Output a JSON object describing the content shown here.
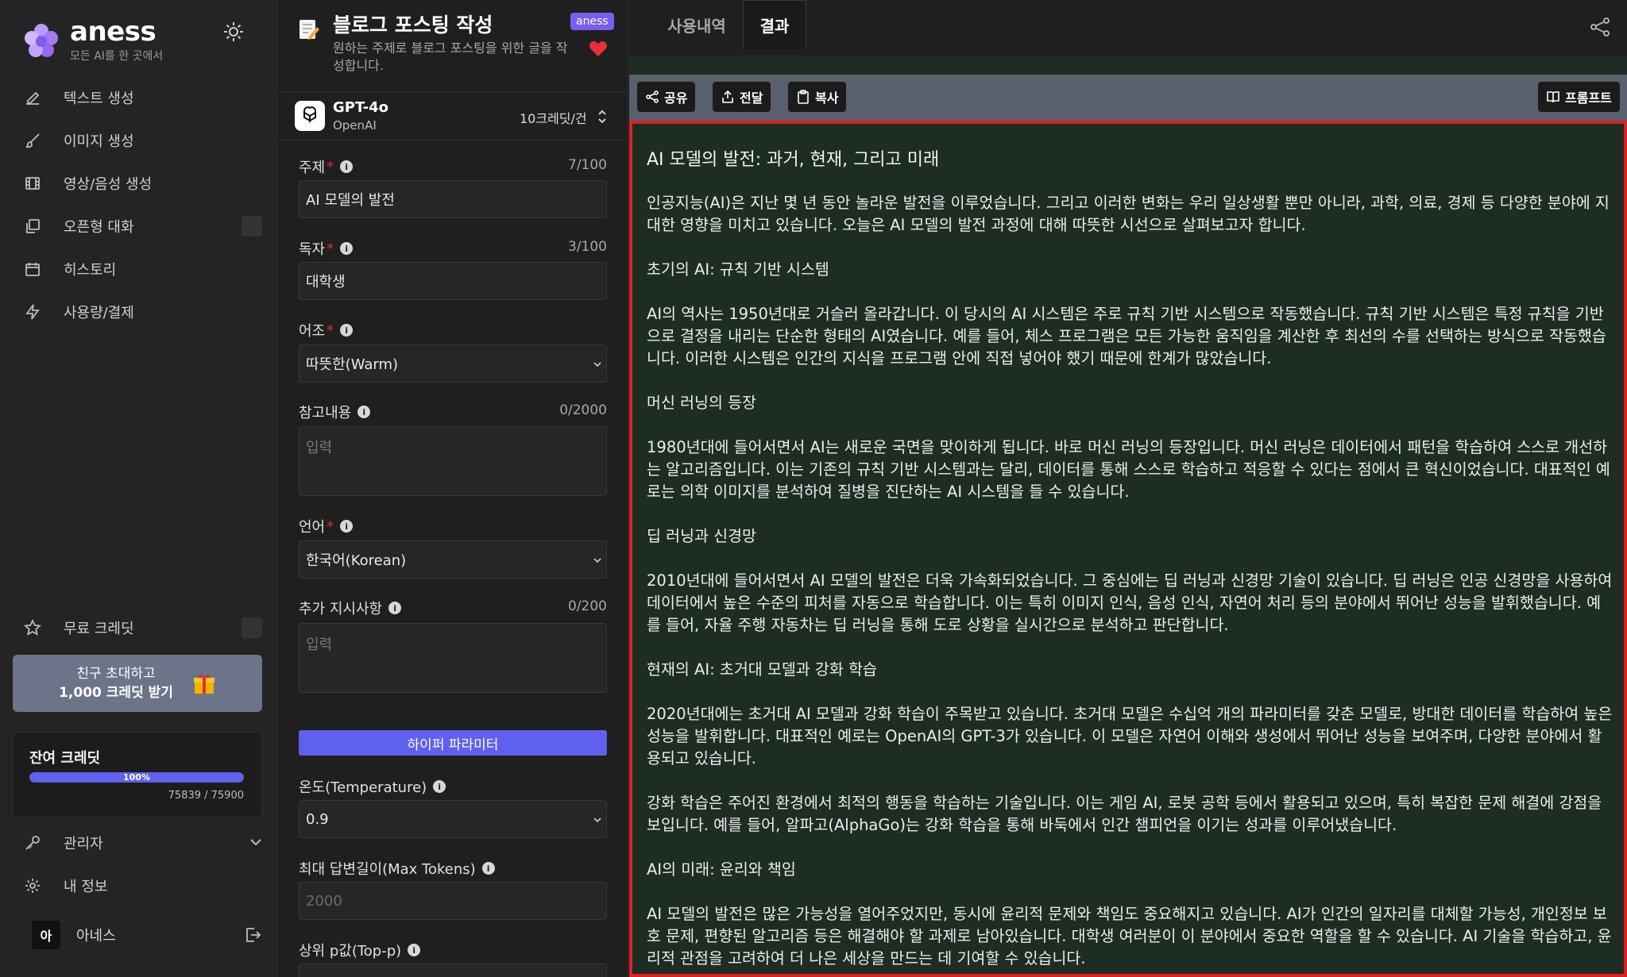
{
  "brand": {
    "name": "aness",
    "tagline": "모든 AI를 한 곳에서"
  },
  "nav": [
    {
      "label": "텍스트 생성",
      "icon": "edit-icon"
    },
    {
      "label": "이미지 생성",
      "icon": "brush-icon"
    },
    {
      "label": "영상/음성 생성",
      "icon": "film-icon"
    },
    {
      "label": "오픈형 대화",
      "icon": "chat-icon"
    },
    {
      "label": "히스토리",
      "icon": "calendar-icon"
    },
    {
      "label": "사용량/결제",
      "icon": "bolt-icon"
    }
  ],
  "free_credit": {
    "label": "무료 크레딧"
  },
  "invite": {
    "line1": "친구 초대하고",
    "line2": "1,000 크레딧 받기"
  },
  "credit": {
    "title": "잔여 크레딧",
    "percent_label": "100%",
    "fill_fraction": 1.0,
    "count": "75839 / 75900"
  },
  "admin": {
    "label": "관리자"
  },
  "my_info": {
    "label": "내 정보"
  },
  "user": {
    "avatar": "아",
    "name": "아네스"
  },
  "tool": {
    "title": "블로그 포스팅 작성",
    "description": "원하는 주제로 블로그 포스팅을 위한 글을 작성합니다.",
    "tag": "aness"
  },
  "model": {
    "name": "GPT-4o",
    "vendor": "OpenAI",
    "price": "10크레딧/건"
  },
  "fields": {
    "topic": {
      "label": "주제",
      "required": "*",
      "count": "7/100",
      "value": "AI 모델의 발전"
    },
    "audience": {
      "label": "독자",
      "required": "*",
      "count": "3/100",
      "value": "대학생"
    },
    "tone": {
      "label": "어조",
      "required": "*",
      "value": "따뜻한(Warm)"
    },
    "reference": {
      "label": "참고내용",
      "count": "0/2000",
      "placeholder": "입력"
    },
    "language": {
      "label": "언어",
      "required": "*",
      "value": "한국어(Korean)"
    },
    "extra": {
      "label": "추가 지시사항",
      "count": "0/200",
      "placeholder": "입력"
    },
    "hyper_button": "하이퍼 파라미터",
    "temperature": {
      "label": "온도(Temperature)",
      "value": "0.9"
    },
    "max_tokens": {
      "label": "최대 답변길이(Max Tokens)",
      "placeholder": "2000"
    },
    "top_p": {
      "label": "상위 p값(Top-p)"
    }
  },
  "tabs": {
    "history": "사용내역",
    "result": "결과"
  },
  "actions": {
    "share": "공유",
    "forward": "전달",
    "copy": "복사",
    "prompt": "프롬프트"
  },
  "article": {
    "title": "AI 모델의 발전: 과거, 현재, 그리고 미래",
    "p1": "인공지능(AI)은 지난 몇 년 동안 놀라운 발전을 이루었습니다. 그리고 이러한 변화는 우리 일상생활 뿐만 아니라, 과학, 의료, 경제 등 다양한 분야에 지대한 영향을 미치고 있습니다. 오늘은 AI 모델의 발전 과정에 대해 따뜻한 시선으로 살펴보고자 합니다.",
    "h1": "초기의 AI: 규칙 기반 시스템",
    "p2": "AI의 역사는 1950년대로 거슬러 올라갑니다. 이 당시의 AI 시스템은 주로 규칙 기반 시스템으로 작동했습니다. 규칙 기반 시스템은 특정 규칙을 기반으로 결정을 내리는 단순한 형태의 AI였습니다. 예를 들어, 체스 프로그램은 모든 가능한 움직임을 계산한 후 최선의 수를 선택하는 방식으로 작동했습니다. 이러한 시스템은 인간의 지식을 프로그램 안에 직접 넣어야 했기 때문에 한계가 많았습니다.",
    "h2": "머신 러닝의 등장",
    "p3": "1980년대에 들어서면서 AI는 새로운 국면을 맞이하게 됩니다. 바로 머신 러닝의 등장입니다. 머신 러닝은 데이터에서 패턴을 학습하여 스스로 개선하는 알고리즘입니다. 이는 기존의 규칙 기반 시스템과는 달리, 데이터를 통해 스스로 학습하고 적응할 수 있다는 점에서 큰 혁신이었습니다. 대표적인 예로는 의학 이미지를 분석하여 질병을 진단하는 AI 시스템을 들 수 있습니다.",
    "h3": "딥 러닝과 신경망",
    "p4": "2010년대에 들어서면서 AI 모델의 발전은 더욱 가속화되었습니다. 그 중심에는 딥 러닝과 신경망 기술이 있습니다. 딥 러닝은 인공 신경망을 사용하여 데이터에서 높은 수준의 피처를 자동으로 학습합니다. 이는 특히 이미지 인식, 음성 인식, 자연어 처리 등의 분야에서 뛰어난 성능을 발휘했습니다. 예를 들어, 자율 주행 자동차는 딥 러닝을 통해 도로 상황을 실시간으로 분석하고 판단합니다.",
    "h4": "현재의 AI: 초거대 모델과 강화 학습",
    "p5": "2020년대에는 초거대 AI 모델과 강화 학습이 주목받고 있습니다. 초거대 모델은 수십억 개의 파라미터를 갖춘 모델로, 방대한 데이터를 학습하여 높은 성능을 발휘합니다. 대표적인 예로는 OpenAI의 GPT-3가 있습니다. 이 모델은 자연어 이해와 생성에서 뛰어난 성능을 보여주며, 다양한 분야에서 활용되고 있습니다.",
    "p6": "강화 학습은 주어진 환경에서 최적의 행동을 학습하는 기술입니다. 이는 게임 AI, 로봇 공학 등에서 활용되고 있으며, 특히 복잡한 문제 해결에 강점을 보입니다. 예를 들어, 알파고(AlphaGo)는 강화 학습을 통해 바둑에서 인간 챔피언을 이기는 성과를 이루어냈습니다.",
    "h5": "AI의 미래: 윤리와 책임",
    "p7": "AI 모델의 발전은 많은 가능성을 열어주었지만, 동시에 윤리적 문제와 책임도 중요해지고 있습니다. AI가 인간의 일자리를 대체할 가능성, 개인정보 보호 문제, 편향된 알고리즘 등은 해결해야 할 과제로 남아있습니다. 대학생 여러분이 이 분야에서 중요한 역할을 할 수 있습니다. AI 기술을 학습하고, 윤리적 관점을 고려하여 더 나은 세상을 만드는 데 기여할 수 있습니다."
  },
  "colors": {
    "accent": "#5f5ff0",
    "highlight_border": "#e0201e",
    "content_bg": "#1e2d23",
    "tag": "#7b5cf0"
  }
}
